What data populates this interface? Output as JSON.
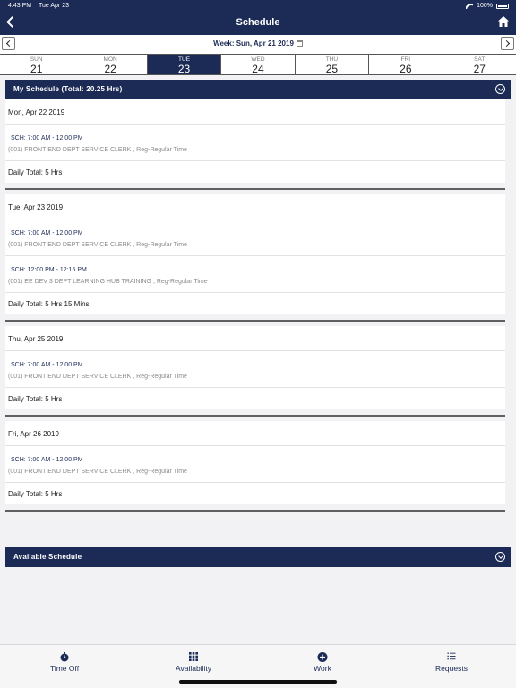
{
  "status_bar": {
    "time": "4:43 PM",
    "date": "Tue Apr 23",
    "battery": "100%"
  },
  "header": {
    "title": "Schedule"
  },
  "week": {
    "label": "Week: Sun, Apr 21 2019"
  },
  "days": [
    {
      "name": "SUN",
      "num": "21"
    },
    {
      "name": "MON",
      "num": "22"
    },
    {
      "name": "TUE",
      "num": "23"
    },
    {
      "name": "WED",
      "num": "24"
    },
    {
      "name": "THU",
      "num": "25"
    },
    {
      "name": "FRI",
      "num": "26"
    },
    {
      "name": "SAT",
      "num": "27"
    }
  ],
  "selected_day": "TUE",
  "my_schedule": {
    "title": "My Schedule (Total: 20.25 Hrs)",
    "days": [
      {
        "date": "Mon, Apr 22 2019",
        "shifts": [
          {
            "time": "SCH: 7:00 AM - 12:00 PM",
            "desc": "(001) FRONT END DEPT SERVICE CLERK , Reg-Regular Time"
          }
        ],
        "total": "Daily Total: 5 Hrs"
      },
      {
        "date": "Tue, Apr 23 2019",
        "shifts": [
          {
            "time": "SCH: 7:00 AM - 12:00 PM",
            "desc": "(001) FRONT END DEPT SERVICE CLERK , Reg-Regular Time"
          },
          {
            "time": "SCH: 12:00 PM - 12:15 PM",
            "desc": "(001) EE DEV 3 DEPT LEARNING HUB TRAINING , Reg-Regular Time"
          }
        ],
        "total": "Daily Total: 5 Hrs 15 Mins"
      },
      {
        "date": "Thu, Apr 25 2019",
        "shifts": [
          {
            "time": "SCH: 7:00 AM - 12:00 PM",
            "desc": "(001) FRONT END DEPT SERVICE CLERK , Reg-Regular Time"
          }
        ],
        "total": "Daily Total: 5 Hrs"
      },
      {
        "date": "Fri, Apr 26 2019",
        "shifts": [
          {
            "time": "SCH: 7:00 AM - 12:00 PM",
            "desc": "(001) FRONT END DEPT SERVICE CLERK , Reg-Regular Time"
          }
        ],
        "total": "Daily Total: 5 Hrs"
      }
    ]
  },
  "available_schedule": {
    "title": "Available Schedule"
  },
  "tabs": [
    {
      "label": "Time Off",
      "icon": "time-off-icon"
    },
    {
      "label": "Availability",
      "icon": "grid-icon"
    },
    {
      "label": "Work",
      "icon": "plus-circle-icon"
    },
    {
      "label": "Requests",
      "icon": "list-icon"
    }
  ],
  "colors": {
    "primary": "#1c2b56",
    "background": "#f2f2f4"
  }
}
